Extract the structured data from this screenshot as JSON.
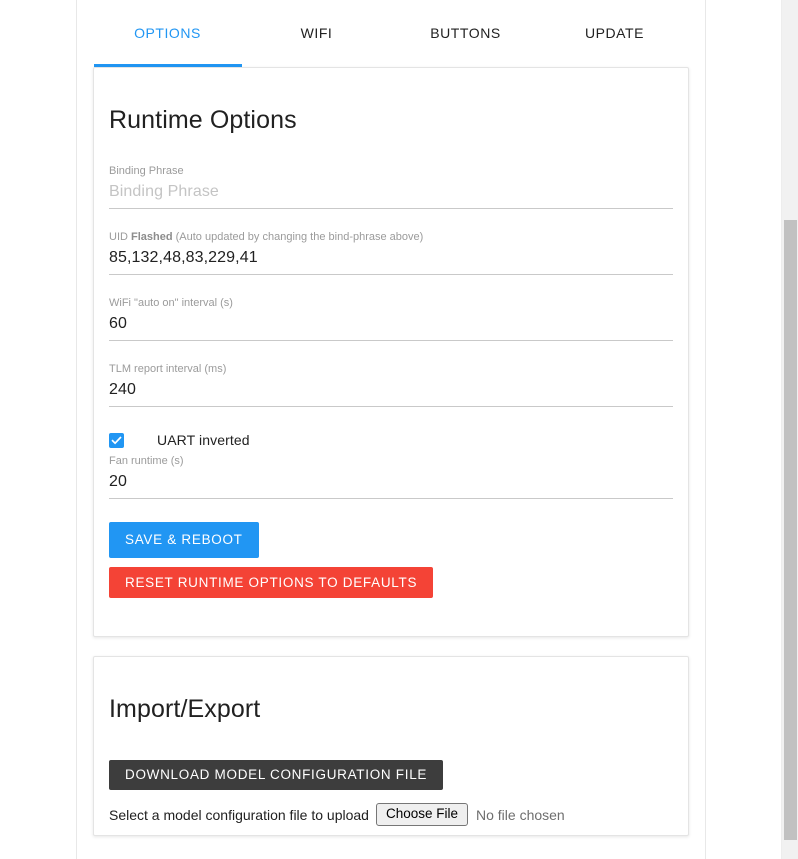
{
  "tabs": [
    {
      "label": "OPTIONS",
      "active": true
    },
    {
      "label": "WIFI",
      "active": false
    },
    {
      "label": "BUTTONS",
      "active": false
    },
    {
      "label": "UPDATE",
      "active": false
    }
  ],
  "runtime_options": {
    "title": "Runtime Options",
    "fields": [
      {
        "label": "Binding Phrase",
        "value": "",
        "placeholder": "Binding Phrase"
      },
      {
        "label_prefix": "UID ",
        "label_bold": "Flashed",
        "label_suffix": " (Auto updated by changing the bind-phrase above)",
        "value": "85,132,48,83,229,41"
      },
      {
        "label": "WiFi \"auto on\" interval (s)",
        "value": "60"
      },
      {
        "label": "TLM report interval (ms)",
        "value": "240"
      },
      {
        "label": "Fan runtime (s)",
        "value": "20"
      }
    ],
    "checkbox": {
      "label": "UART inverted",
      "checked": true
    },
    "save_button": "SAVE & REBOOT",
    "reset_button": "RESET RUNTIME OPTIONS TO DEFAULTS"
  },
  "import_export": {
    "title": "Import/Export",
    "download_button": "DOWNLOAD MODEL CONFIGURATION FILE",
    "upload_label": "Select a model configuration file to upload",
    "choose_file_button": "Choose File",
    "no_file_text": "No file chosen"
  },
  "colors": {
    "accent": "#2196f3",
    "danger": "#f44336",
    "dark": "#3d3d3d",
    "text": "#212121",
    "muted": "#9b9b9b"
  }
}
